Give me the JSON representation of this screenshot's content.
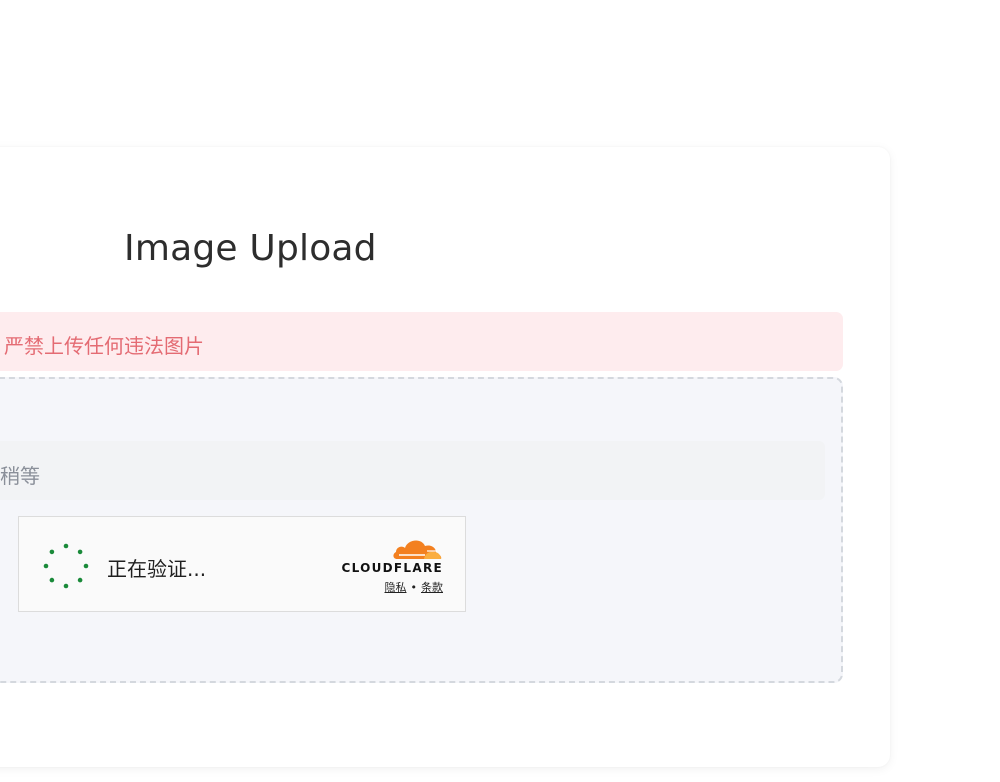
{
  "page": {
    "title": "Image Upload"
  },
  "alert": {
    "text": "严禁上传任何违法图片",
    "color": "#e46b73",
    "background": "#feecee"
  },
  "uploader": {
    "status_text": "请稍等"
  },
  "turnstile": {
    "status_text": "正在验证...",
    "spinner_color": "#1a8a3a",
    "brand": "CLOUDFLARE",
    "brand_color": "#f38020",
    "privacy_link": "隐私",
    "separator": "•",
    "terms_link": "条款"
  }
}
